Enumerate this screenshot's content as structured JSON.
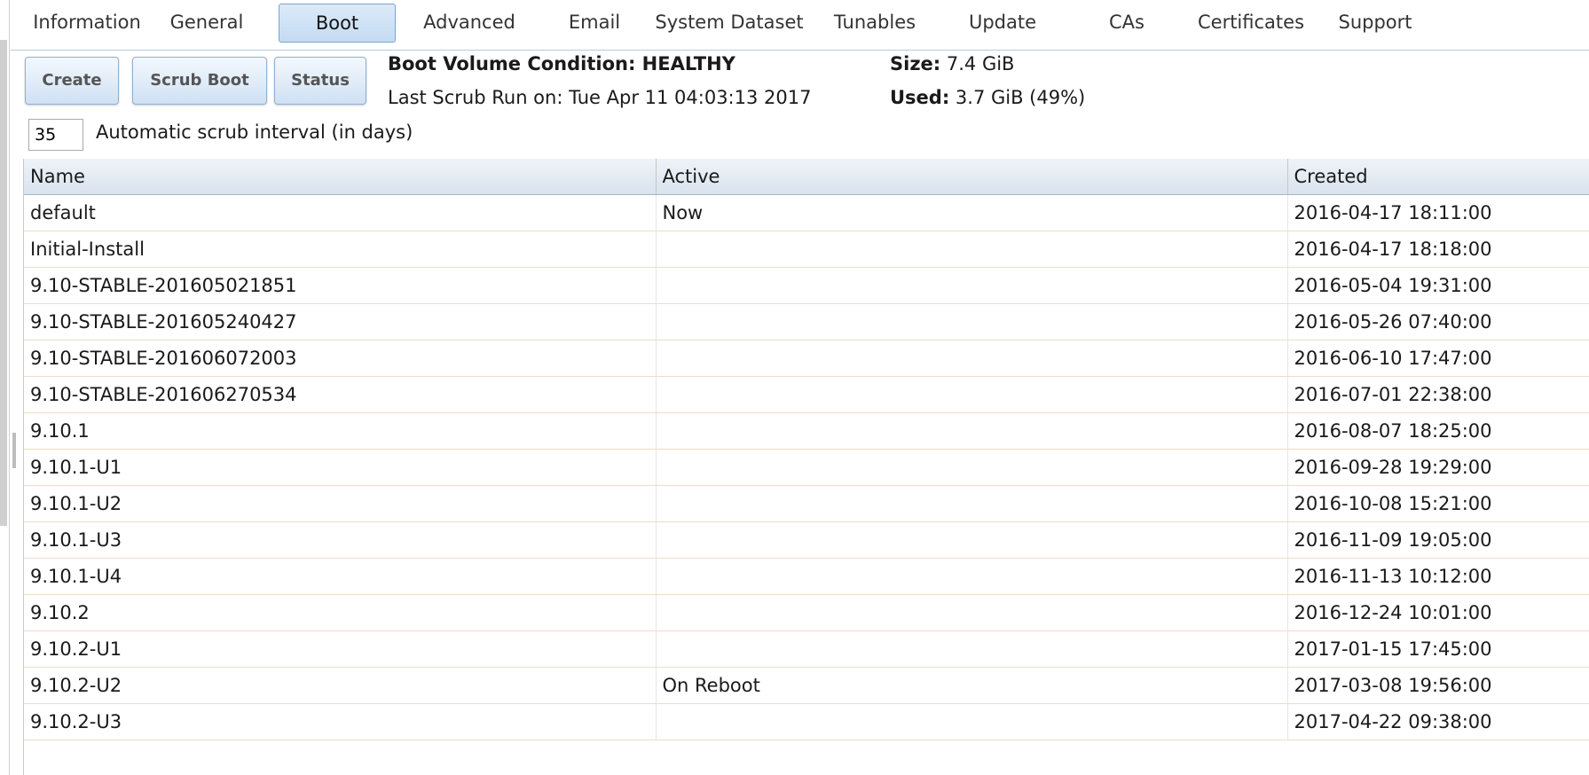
{
  "tabs": [
    "Information",
    "General",
    "Boot",
    "Advanced",
    "Email",
    "System Dataset",
    "Tunables",
    "Update",
    "CAs",
    "Certificates",
    "Support"
  ],
  "active_tab": "Boot",
  "toolbar": {
    "create_label": "Create",
    "scrub_boot_label": "Scrub Boot",
    "status_label": "Status"
  },
  "status": {
    "condition_label": "Boot Volume Condition: HEALTHY",
    "last_scrub": "Last Scrub Run on: Tue Apr 11 04:03:13 2017",
    "size_label": "Size:",
    "size_value": "7.4 GiB",
    "used_label": "Used:",
    "used_value": "3.7 GiB (49%)"
  },
  "scrub_interval": {
    "value": "35",
    "label": "Automatic scrub interval (in days)"
  },
  "table": {
    "columns": [
      "Name",
      "Active",
      "Created"
    ],
    "rows": [
      [
        "default",
        "Now",
        "2016-04-17 18:11:00"
      ],
      [
        "Initial-Install",
        "",
        "2016-04-17 18:18:00"
      ],
      [
        "9.10-STABLE-201605021851",
        "",
        "2016-05-04 19:31:00"
      ],
      [
        "9.10-STABLE-201605240427",
        "",
        "2016-05-26 07:40:00"
      ],
      [
        "9.10-STABLE-201606072003",
        "",
        "2016-06-10 17:47:00"
      ],
      [
        "9.10-STABLE-201606270534",
        "",
        "2016-07-01 22:38:00"
      ],
      [
        "9.10.1",
        "",
        "2016-08-07 18:25:00"
      ],
      [
        "9.10.1-U1",
        "",
        "2016-09-28 19:29:00"
      ],
      [
        "9.10.1-U2",
        "",
        "2016-10-08 15:21:00"
      ],
      [
        "9.10.1-U3",
        "",
        "2016-11-09 19:05:00"
      ],
      [
        "9.10.1-U4",
        "",
        "2016-11-13 10:12:00"
      ],
      [
        "9.10.2",
        "",
        "2016-12-24 10:01:00"
      ],
      [
        "9.10.2-U1",
        "",
        "2017-01-15 17:45:00"
      ],
      [
        "9.10.2-U2",
        "On Reboot",
        "2017-03-08 19:56:00"
      ],
      [
        "9.10.2-U3",
        "",
        "2017-04-22 09:38:00"
      ]
    ]
  }
}
